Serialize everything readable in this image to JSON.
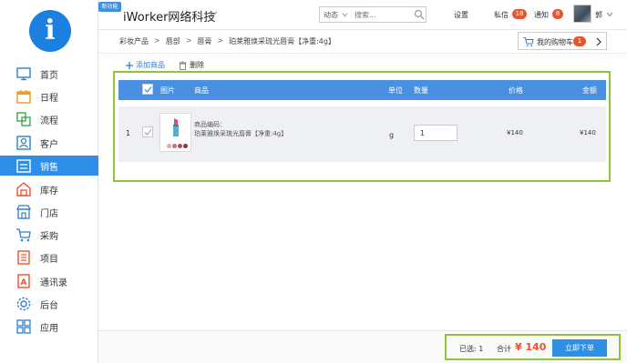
{
  "logo": {
    "glyph": "i"
  },
  "sidebar": {
    "items": [
      {
        "label": "首页",
        "icon": "monitor-icon"
      },
      {
        "label": "日程",
        "icon": "calendar-icon"
      },
      {
        "label": "流程",
        "icon": "flow-icon"
      },
      {
        "label": "客户",
        "icon": "customer-icon"
      },
      {
        "label": "销售",
        "icon": "sales-icon",
        "active": true
      },
      {
        "label": "库存",
        "icon": "warehouse-icon"
      },
      {
        "label": "门店",
        "icon": "store-icon"
      },
      {
        "label": "采购",
        "icon": "cart-icon"
      },
      {
        "label": "项目",
        "icon": "project-icon"
      },
      {
        "label": "通讯录",
        "icon": "contacts-icon"
      },
      {
        "label": "后台",
        "icon": "gear-icon"
      },
      {
        "label": "应用",
        "icon": "apps-icon"
      }
    ]
  },
  "header": {
    "new_badge": "新功能",
    "company": "iWorker网络科技",
    "search_scope": "动态",
    "search_placeholder": "搜索...",
    "settings": "设置",
    "messages": "私信",
    "messages_count": "18",
    "notices": "通知",
    "notices_count": "8",
    "user": "郭"
  },
  "breadcrumb": {
    "items": [
      "彩妆产品",
      "唇部",
      "唇膏",
      "珀莱雅焕采琉光唇膏【净重:4g】"
    ],
    "separator": ">"
  },
  "cart": {
    "label": "我的购物车",
    "count": "1"
  },
  "actions": {
    "add": "添加商品",
    "delete": "删除"
  },
  "table": {
    "headers": {
      "image": "图片",
      "product": "商品",
      "unit": "单位",
      "quantity": "数量",
      "price": "价格",
      "amount": "金额"
    },
    "rows": [
      {
        "index": "1",
        "code_label": "商品编码：",
        "name": "珀莱雅焕采琉光唇膏【净重:4g】",
        "unit": "g",
        "quantity": "1",
        "price": "¥140",
        "amount": "¥140"
      }
    ]
  },
  "summary": {
    "selected": "已选: 1",
    "total_label": "合计",
    "total_value": "¥ 140",
    "order_button": "立即下单"
  },
  "colors": {
    "accent": "#2f8ee6",
    "highlight": "#8fc33a",
    "badge": "#e8542e"
  }
}
